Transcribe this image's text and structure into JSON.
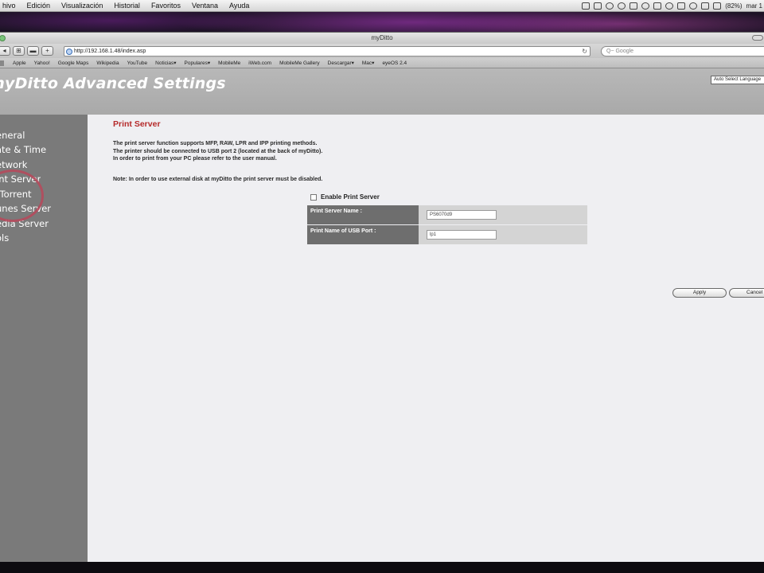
{
  "menubar": {
    "items": [
      "hivo",
      "Edición",
      "Visualización",
      "Historial",
      "Favoritos",
      "Ventana",
      "Ayuda"
    ],
    "battery": "(82%)",
    "clock": "mar 1"
  },
  "browser": {
    "window_title": "myDitto",
    "url": "http://192.168.1.48/index.asp",
    "search_placeholder": "Q~ Google",
    "bookmarks": [
      "Apple",
      "Yahoo!",
      "Google Maps",
      "Wikipedia",
      "YouTube",
      "Noticias▾",
      "Populares▾",
      "MobileMe",
      "iWeb.com",
      "MobileMe Gallery",
      "Descargar▾",
      "Mac▾",
      "eyeOS 2.4"
    ]
  },
  "header": {
    "title": "myDitto Advanced Settings",
    "language_select": "Auto Select Language"
  },
  "sidebar": {
    "items": [
      {
        "label": "eneral"
      },
      {
        "label": "ate & Time"
      },
      {
        "label": "etwork"
      },
      {
        "label": "int Server"
      },
      {
        "label": "tTorrent"
      },
      {
        "label": "unes Server"
      },
      {
        "label": "edia Server"
      },
      {
        "label": "ols"
      }
    ]
  },
  "content": {
    "section_title": "Print Server",
    "desc_line1": "The print server function supports MFP, RAW, LPR and IPP printing methods.",
    "desc_line2": "The printer should be connected to USB port 2 (located at the back of myDitto).",
    "desc_line3": "In order to print from your PC please refer to the user manual.",
    "note": "Note: In order to use external disk at myDitto the print server must be disabled.",
    "enable_label": "Enable Print Server",
    "enable_checked": false,
    "fields": [
      {
        "label": "Print Server Name :",
        "value": "PS6070d9"
      },
      {
        "label": "Print Name of USB Port :",
        "value": "lp1"
      }
    ],
    "apply_label": "Apply",
    "cancel_label": "Cancel"
  }
}
